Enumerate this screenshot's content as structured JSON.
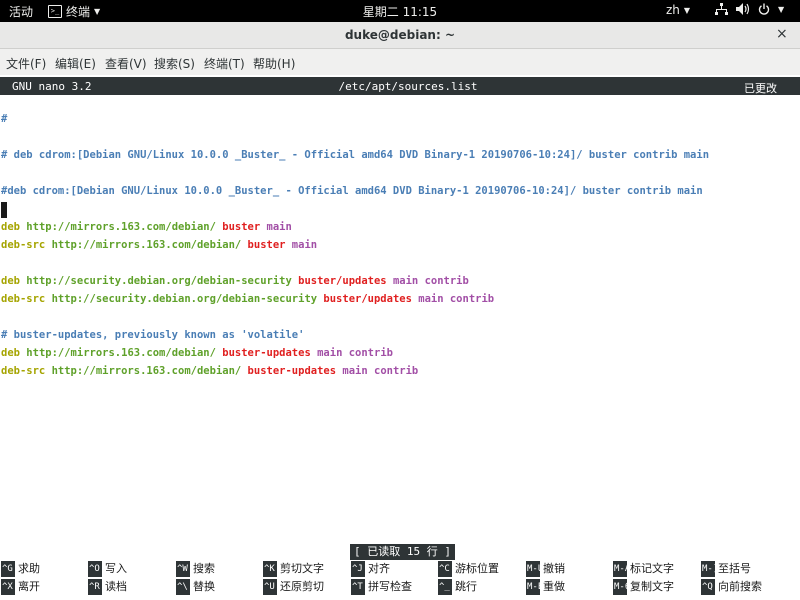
{
  "topbar": {
    "activities": "活动",
    "app_name": "终端",
    "clock": "星期二 11:15",
    "input_method": "zh"
  },
  "window": {
    "title": "duke@debian: ~",
    "close_glyph": "×"
  },
  "menubar": [
    "文件(F)",
    "编辑(E)",
    "查看(V)",
    "搜索(S)",
    "终端(T)",
    "帮助(H)"
  ],
  "nano": {
    "version": "GNU nano 3.2",
    "filename": "/etc/apt/sources.list",
    "modified": "已更改",
    "status_message": "[ 已读取 15 行 ]"
  },
  "file_lines": [
    [
      {
        "t": "#",
        "c": "cmt"
      }
    ],
    [],
    [
      {
        "t": "# deb cdrom:[Debian GNU/Linux 10.0.0 _Buster_ - Official amd64 DVD Binary-1 20190706-10:24]/ buster contrib main",
        "c": "cmt"
      }
    ],
    [],
    [
      {
        "t": "#deb cdrom:[Debian GNU/Linux 10.0.0 _Buster_ - Official amd64 DVD Binary-1 20190706-10:24]/ buster contrib main",
        "c": "cmt"
      }
    ],
    [],
    [
      {
        "t": "deb ",
        "c": "kw"
      },
      {
        "t": "http://mirrors.163.com/debian/ ",
        "c": "url"
      },
      {
        "t": "buster",
        "c": "rel"
      },
      {
        "t": " main",
        "c": "comp"
      }
    ],
    [
      {
        "t": "deb-src ",
        "c": "kw"
      },
      {
        "t": "http://mirrors.163.com/debian/ ",
        "c": "url"
      },
      {
        "t": "buster",
        "c": "rel"
      },
      {
        "t": " main",
        "c": "comp"
      }
    ],
    [],
    [
      {
        "t": "deb ",
        "c": "kw"
      },
      {
        "t": "http://security.debian.org/debian-security ",
        "c": "url"
      },
      {
        "t": "buster/updates",
        "c": "rel"
      },
      {
        "t": " main contrib",
        "c": "comp"
      }
    ],
    [
      {
        "t": "deb-src ",
        "c": "kw"
      },
      {
        "t": "http://security.debian.org/debian-security ",
        "c": "url"
      },
      {
        "t": "buster/updates",
        "c": "rel"
      },
      {
        "t": " main contrib",
        "c": "comp"
      }
    ],
    [],
    [
      {
        "t": "# buster-updates, previously known as 'volatile'",
        "c": "cmt"
      }
    ],
    [
      {
        "t": "deb ",
        "c": "kw"
      },
      {
        "t": "http://mirrors.163.com/debian/ ",
        "c": "url"
      },
      {
        "t": "buster-updates",
        "c": "rel"
      },
      {
        "t": " main contrib",
        "c": "comp"
      }
    ],
    [
      {
        "t": "deb-src ",
        "c": "kw"
      },
      {
        "t": "http://mirrors.163.com/debian/ ",
        "c": "url"
      },
      {
        "t": "buster-updates",
        "c": "rel"
      },
      {
        "t": " main contrib",
        "c": "comp"
      }
    ]
  ],
  "shortcuts": [
    {
      "key": "^G",
      "label": "求助"
    },
    {
      "key": "^O",
      "label": "写入"
    },
    {
      "key": "^W",
      "label": "搜索"
    },
    {
      "key": "^K",
      "label": "剪切文字"
    },
    {
      "key": "^J",
      "label": "对齐"
    },
    {
      "key": "^C",
      "label": "游标位置"
    },
    {
      "key": "M-U",
      "label": "撤销"
    },
    {
      "key": "M-A",
      "label": "标记文字"
    },
    {
      "key": "M-]",
      "label": "至括号"
    },
    {
      "key": "^X",
      "label": "离开"
    },
    {
      "key": "^R",
      "label": "读档"
    },
    {
      "key": "^\\",
      "label": "替换"
    },
    {
      "key": "^U",
      "label": "还原剪切"
    },
    {
      "key": "^T",
      "label": "拼写检查"
    },
    {
      "key": "^_",
      "label": "跳行"
    },
    {
      "key": "M-E",
      "label": "重做"
    },
    {
      "key": "M-6",
      "label": "复制文字"
    },
    {
      "key": "^Q",
      "label": "向前搜索"
    }
  ],
  "colors": {
    "comment": "#4a7eb5",
    "keyword": "#a5a400",
    "url": "#5fa12a",
    "release": "#e02020",
    "component": "#a24fa6",
    "bar_bg": "#2e3436"
  },
  "icons": [
    "terminal-icon",
    "network-icon",
    "volume-icon",
    "power-icon",
    "close-icon"
  ]
}
